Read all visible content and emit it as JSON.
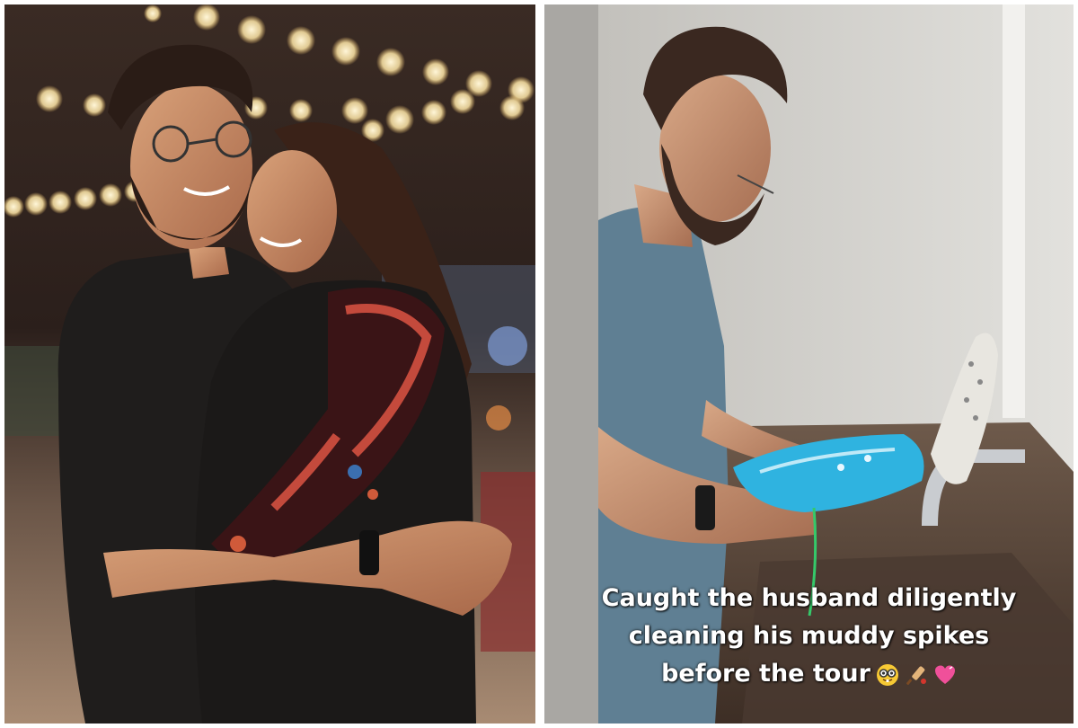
{
  "left_photo": {
    "description_icon": "couple-photo"
  },
  "right_photo": {
    "description_icon": "cleaning-shoes-photo",
    "caption_lines": [
      "Caught the husband diligently",
      "cleaning his muddy spikes",
      "before the tour"
    ],
    "emojis": [
      "nerd-face-icon",
      "cricket-bat-icon",
      "heart-icon"
    ]
  },
  "colors": {
    "caption_text": "#ffffff",
    "shoe_blue": "#2fb3e0",
    "shirt_grey": "#5f7f93"
  }
}
